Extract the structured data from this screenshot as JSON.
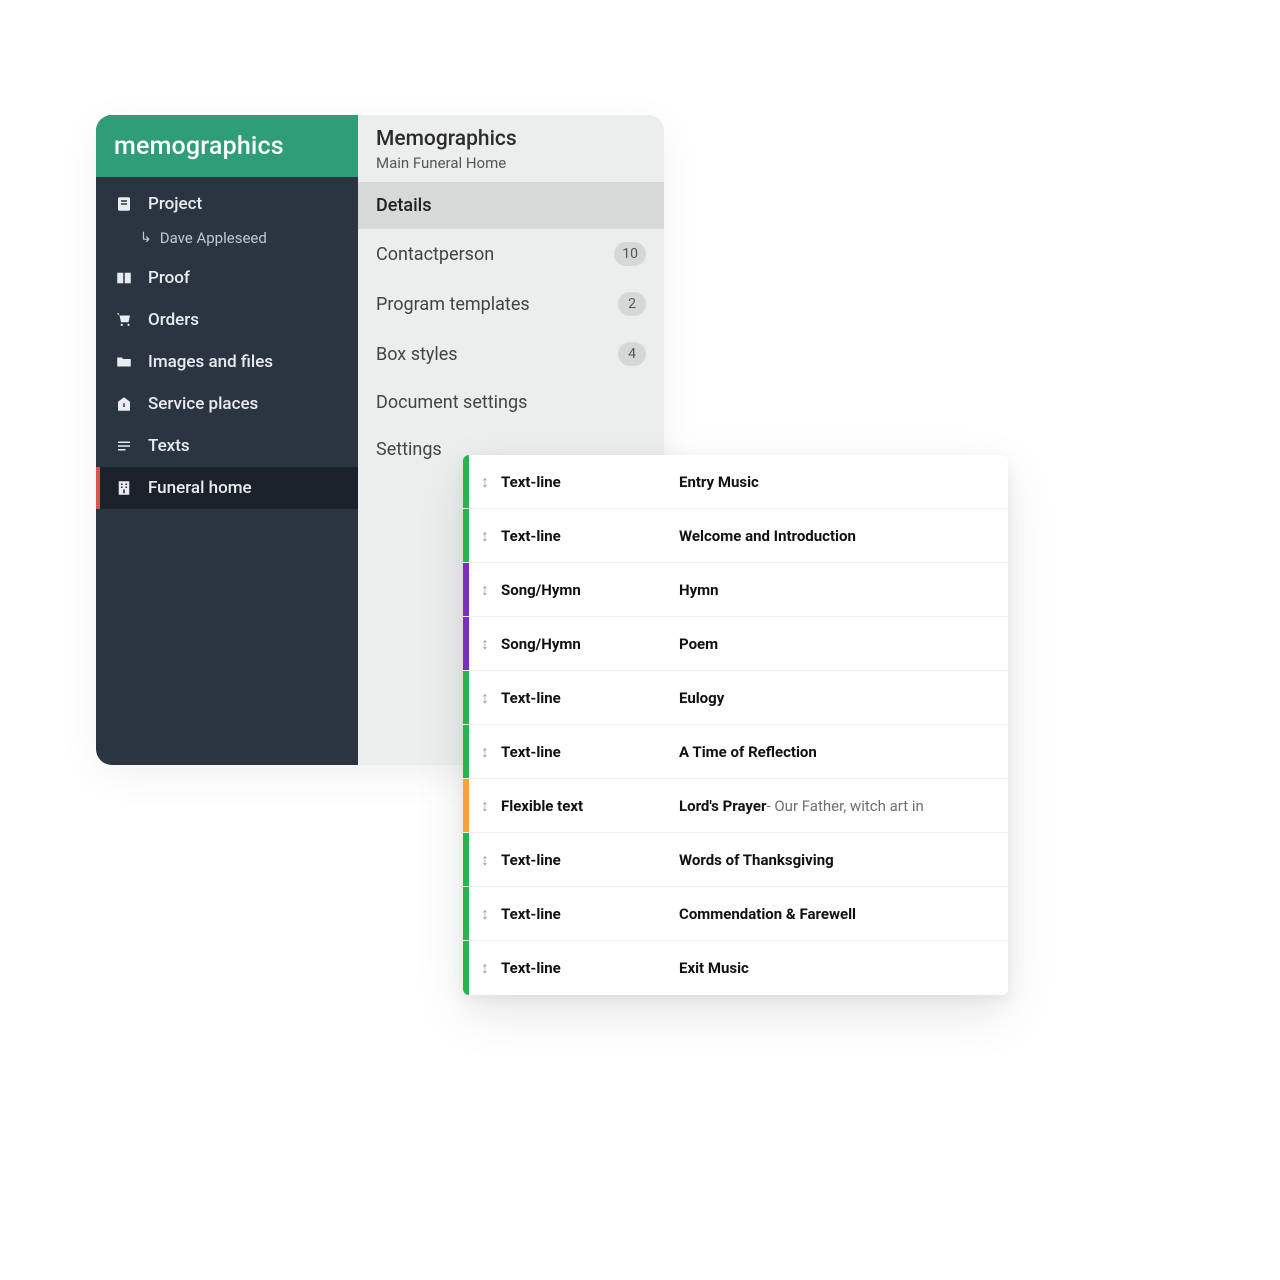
{
  "brand": "memographics",
  "sidebar": {
    "items": [
      {
        "label": "Project",
        "icon": "project-icon"
      },
      {
        "label": "Proof",
        "icon": "proof-icon"
      },
      {
        "label": "Orders",
        "icon": "orders-icon"
      },
      {
        "label": "Images and files",
        "icon": "files-icon"
      },
      {
        "label": "Service places",
        "icon": "places-icon"
      },
      {
        "label": "Texts",
        "icon": "texts-icon"
      },
      {
        "label": "Funeral home",
        "icon": "funeral-home-icon"
      }
    ],
    "project_sub": "Dave Appleseed",
    "active_index": 6
  },
  "panel": {
    "title": "Memographics",
    "subtitle": "Main Funeral Home",
    "tabs": [
      {
        "label": "Details",
        "badge": null,
        "selected": true
      },
      {
        "label": "Contactperson",
        "badge": "10",
        "selected": false
      },
      {
        "label": "Program templates",
        "badge": "2",
        "selected": false
      },
      {
        "label": "Box styles",
        "badge": "4",
        "selected": false
      },
      {
        "label": "Document settings",
        "badge": null,
        "selected": false
      },
      {
        "label": "Settings",
        "badge": null,
        "selected": false
      }
    ]
  },
  "program": {
    "rows": [
      {
        "accent": "green",
        "type": "Text-line",
        "title": "Entry Music",
        "extra": ""
      },
      {
        "accent": "green",
        "type": "Text-line",
        "title": "Welcome and Introduction",
        "extra": ""
      },
      {
        "accent": "purple",
        "type": "Song/Hymn",
        "title": "Hymn",
        "extra": ""
      },
      {
        "accent": "purple",
        "type": "Song/Hymn",
        "title": "Poem",
        "extra": ""
      },
      {
        "accent": "green",
        "type": "Text-line",
        "title": "Eulogy",
        "extra": ""
      },
      {
        "accent": "green",
        "type": "Text-line",
        "title": "A Time of Reflection",
        "extra": ""
      },
      {
        "accent": "orange",
        "type": "Flexible text",
        "title": "Lord's Prayer",
        "extra": " - Our Father, witch art in"
      },
      {
        "accent": "green",
        "type": "Text-line",
        "title": "Words of Thanksgiving",
        "extra": ""
      },
      {
        "accent": "green",
        "type": "Text-line",
        "title": "Commendation & Farewell",
        "extra": ""
      },
      {
        "accent": "green",
        "type": "Text-line",
        "title": "Exit Music",
        "extra": ""
      }
    ]
  }
}
